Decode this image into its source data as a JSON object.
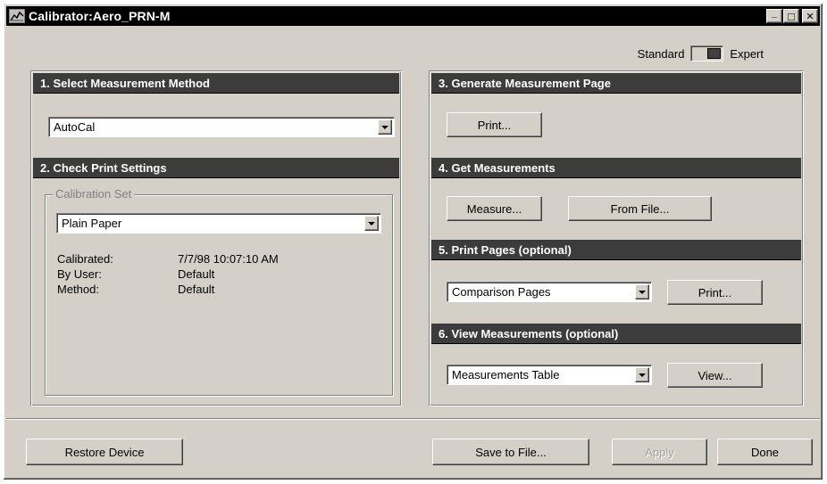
{
  "window": {
    "title": "Calibrator:Aero_PRN-M",
    "minimize_glyph": "_",
    "maximize_glyph": "□",
    "close_glyph": "✕"
  },
  "mode": {
    "standard_label": "Standard",
    "expert_label": "Expert",
    "selected": "Expert"
  },
  "sections": {
    "s1": {
      "title": "1. Select Measurement Method",
      "method_value": "AutoCal"
    },
    "s2": {
      "title": "2. Check Print Settings",
      "group_label": "Calibration Set",
      "calibration_set_value": "Plain Paper",
      "details": [
        {
          "key": "Calibrated:",
          "value": "7/7/98 10:07:10 AM"
        },
        {
          "key": "By User:",
          "value": "Default"
        },
        {
          "key": "Method:",
          "value": "Default"
        }
      ]
    },
    "s3": {
      "title": "3. Generate Measurement Page",
      "print_label": "Print..."
    },
    "s4": {
      "title": "4. Get Measurements",
      "measure_label": "Measure...",
      "from_file_label": "From File..."
    },
    "s5": {
      "title": "5. Print Pages (optional)",
      "pages_value": "Comparison Pages",
      "print_label": "Print..."
    },
    "s6": {
      "title": "6. View Measurements (optional)",
      "view_type_value": "Measurements Table",
      "view_label": "View..."
    }
  },
  "footer": {
    "restore_label": "Restore Device",
    "save_label": "Save to File...",
    "apply_label": "Apply",
    "done_label": "Done"
  },
  "colors": {
    "face": "#d4d0c8",
    "header": "#3c3c3c",
    "titlebar": "#000000"
  }
}
